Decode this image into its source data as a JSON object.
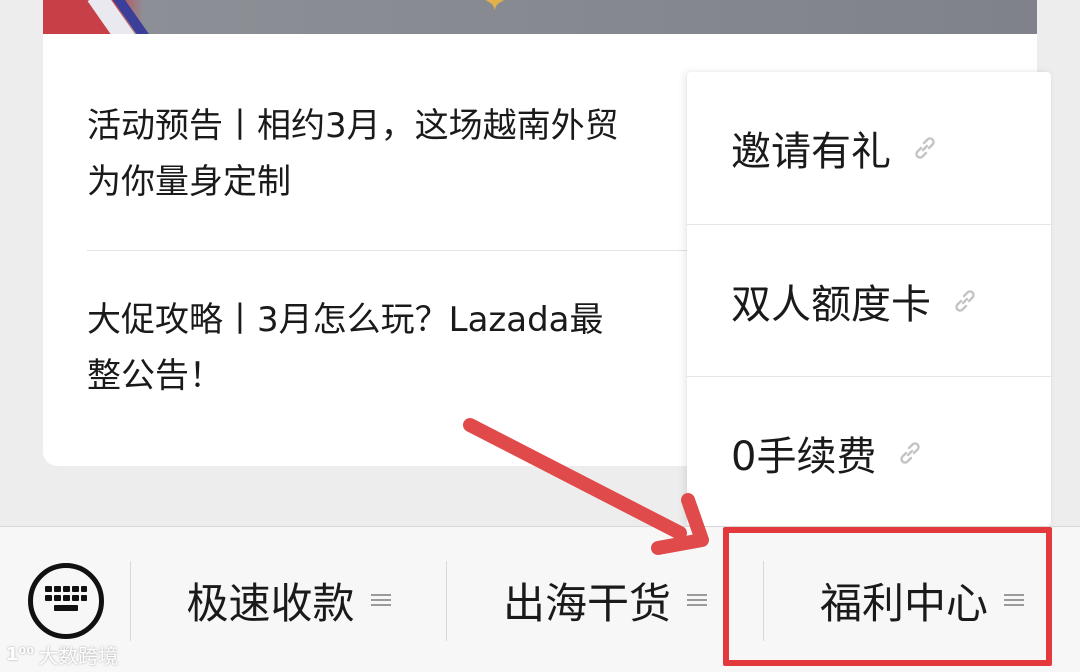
{
  "articles": [
    {
      "line1": "活动预告丨相约3月，这场越南外贸",
      "line2": "为你量身定制"
    },
    {
      "line1": "大促攻略丨3月怎么玩？Lazada最",
      "line2": "整公告！"
    }
  ],
  "popup": {
    "items": [
      {
        "label": "邀请有礼",
        "icon": "link-icon"
      },
      {
        "label": "双人额度卡",
        "icon": "link-icon"
      },
      {
        "label": "0手续费",
        "icon": "link-icon"
      }
    ]
  },
  "menubar": {
    "keyboard_icon": "keyboard-icon",
    "items": [
      {
        "label": "极速收款",
        "icon": "menu-lines-icon"
      },
      {
        "label": "出海干货",
        "icon": "menu-lines-icon"
      },
      {
        "label": "福利中心",
        "icon": "menu-lines-icon"
      }
    ]
  },
  "watermark": {
    "logo": "1⁰⁰",
    "text": "大数跨境"
  },
  "colors": {
    "highlight": "#e3383c",
    "arrow": "#e14a4a",
    "background": "#ededed",
    "card": "#ffffff"
  }
}
